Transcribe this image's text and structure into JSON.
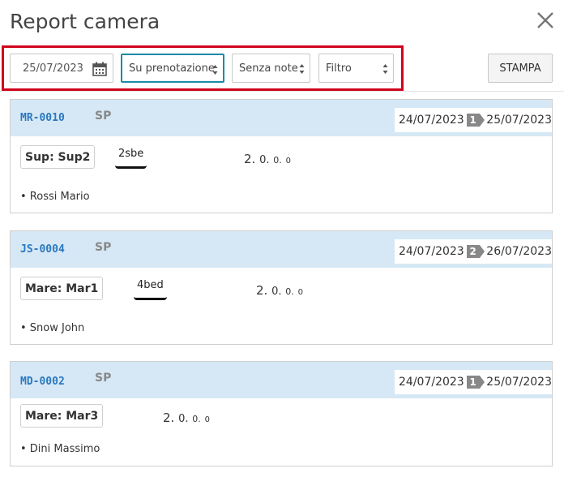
{
  "dialog": {
    "title": "Report camera",
    "close_icon": "close-icon"
  },
  "toolbar": {
    "date_value": "25/07/2023",
    "booking_filter": "Su prenotazione",
    "notes_filter": "Senza note",
    "generic_filter": "Filtro",
    "print_label": "STAMPA",
    "highlight_color": "#d0021b"
  },
  "cards": [
    {
      "code": "MR-0010",
      "status": "SP",
      "date_from": "24/07/2023",
      "nights": "1",
      "date_to": "25/07/2023",
      "room": "Sup: Sup2",
      "room_type": "2sbe",
      "guests": [
        "2.",
        "0.",
        "0.",
        "0"
      ],
      "guest_name": "• Rossi Mario"
    },
    {
      "code": "JS-0004",
      "status": "SP",
      "date_from": "24/07/2023",
      "nights": "2",
      "date_to": "26/07/2023",
      "room": "Mare: Mar1",
      "room_type": "4bed",
      "guests": [
        "2.",
        "0.",
        "0.",
        "0"
      ],
      "guest_name": "• Snow John"
    },
    {
      "code": "MD-0002",
      "status": "SP",
      "date_from": "24/07/2023",
      "nights": "1",
      "date_to": "25/07/2023",
      "room": "Mare: Mar3",
      "room_type": "",
      "guests": [
        "2.",
        "0.",
        "0.",
        "0"
      ],
      "guest_name": "• Dini Massimo"
    }
  ],
  "colors": {
    "header_bg": "#d6e8f5",
    "code": "#2a78c0",
    "select_focus": "#1b8aa8",
    "nights_badge": "#888888"
  }
}
